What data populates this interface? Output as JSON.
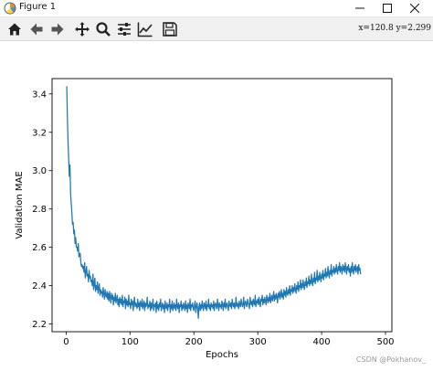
{
  "window": {
    "title": "Figure 1",
    "controls": [
      "minimize",
      "maximize",
      "close"
    ]
  },
  "toolbar": {
    "buttons": [
      "home-icon",
      "back-icon",
      "forward-icon",
      "pan-icon",
      "zoom-icon",
      "configure-subplots-icon",
      "edit-axis-icon",
      "save-icon"
    ],
    "coords": "x=120.8  y=2.299"
  },
  "watermark": "CSDN @Pokhanov_",
  "chart_data": {
    "type": "line",
    "title": "",
    "xlabel": "Epochs",
    "ylabel": "Validation MAE",
    "xlim": [
      -22,
      510
    ],
    "ylim": [
      2.16,
      3.48
    ],
    "xticks": [
      0,
      100,
      200,
      300,
      400,
      500
    ],
    "yticks": [
      2.2,
      2.4,
      2.6,
      2.8,
      3.0,
      3.2,
      3.4
    ],
    "grid": false,
    "line_color": "#1f77b4",
    "series": [
      {
        "name": "",
        "x_start": 1,
        "values": [
          3.44,
          3.28,
          3.15,
          3.06,
          2.97,
          3.03,
          2.88,
          2.83,
          2.78,
          2.72,
          2.73,
          2.67,
          2.69,
          2.62,
          2.65,
          2.6,
          2.6,
          2.58,
          2.62,
          2.55,
          2.56,
          2.57,
          2.52,
          2.5,
          2.51,
          2.49,
          2.5,
          2.47,
          2.52,
          2.44,
          2.47,
          2.5,
          2.45,
          2.46,
          2.42,
          2.48,
          2.44,
          2.45,
          2.42,
          2.43,
          2.4,
          2.46,
          2.38,
          2.41,
          2.44,
          2.37,
          2.4,
          2.38,
          2.42,
          2.36,
          2.39,
          2.41,
          2.35,
          2.38,
          2.36,
          2.37,
          2.34,
          2.39,
          2.36,
          2.33,
          2.38,
          2.35,
          2.34,
          2.37,
          2.33,
          2.36,
          2.32,
          2.37,
          2.34,
          2.31,
          2.36,
          2.33,
          2.35,
          2.3,
          2.34,
          2.32,
          2.36,
          2.31,
          2.33,
          2.35,
          2.3,
          2.33,
          2.29,
          2.34,
          2.31,
          2.33,
          2.3,
          2.35,
          2.29,
          2.32,
          2.31,
          2.34,
          2.28,
          2.33,
          2.3,
          2.32,
          2.29,
          2.35,
          2.3,
          2.31,
          2.28,
          2.33,
          2.3,
          2.32,
          2.27,
          2.31,
          2.34,
          2.29,
          2.31,
          2.3,
          2.28,
          2.33,
          2.29,
          2.31,
          2.27,
          2.32,
          2.3,
          2.29,
          2.33,
          2.28,
          2.3,
          2.32,
          2.27,
          2.31,
          2.29,
          2.3,
          2.34,
          2.28,
          2.3,
          2.29,
          2.32,
          2.27,
          2.31,
          2.28,
          2.3,
          2.33,
          2.27,
          2.3,
          2.29,
          2.31,
          2.26,
          2.32,
          2.28,
          2.3,
          2.27,
          2.31,
          2.29,
          2.33,
          2.27,
          2.29,
          2.31,
          2.28,
          2.3,
          2.26,
          2.32,
          2.29,
          2.28,
          2.31,
          2.27,
          2.3,
          2.29,
          2.33,
          2.26,
          2.3,
          2.28,
          2.32,
          2.27,
          2.29,
          2.31,
          2.28,
          2.3,
          2.27,
          2.33,
          2.29,
          2.28,
          2.31,
          2.26,
          2.3,
          2.29,
          2.32,
          2.27,
          2.3,
          2.28,
          2.31,
          2.29,
          2.27,
          2.32,
          2.28,
          2.3,
          2.26,
          2.31,
          2.29,
          2.28,
          2.33,
          2.27,
          2.3,
          2.29,
          2.31,
          2.28,
          2.27,
          2.3,
          2.32,
          2.26,
          2.29,
          2.31,
          2.28,
          2.23,
          2.29,
          2.31,
          2.27,
          2.3,
          2.28,
          2.32,
          2.29,
          2.27,
          2.31,
          2.3,
          2.28,
          2.32,
          2.27,
          2.3,
          2.29,
          2.33,
          2.28,
          2.3,
          2.27,
          2.31,
          2.29,
          2.3,
          2.28,
          2.32,
          2.27,
          2.3,
          2.31,
          2.29,
          2.28,
          2.33,
          2.3,
          2.27,
          2.31,
          2.29,
          2.3,
          2.28,
          2.32,
          2.3,
          2.27,
          2.31,
          2.29,
          2.33,
          2.28,
          2.3,
          2.31,
          2.29,
          2.27,
          2.32,
          2.3,
          2.29,
          2.31,
          2.28,
          2.33,
          2.3,
          2.29,
          2.31,
          2.28,
          2.3,
          2.34,
          2.29,
          2.31,
          2.3,
          2.28,
          2.32,
          2.3,
          2.29,
          2.33,
          2.31,
          2.29,
          2.3,
          2.34,
          2.28,
          2.31,
          2.32,
          2.3,
          2.29,
          2.33,
          2.31,
          2.3,
          2.28,
          2.34,
          2.31,
          2.3,
          2.32,
          2.29,
          2.33,
          2.31,
          2.3,
          2.35,
          2.29,
          2.32,
          2.31,
          2.33,
          2.3,
          2.34,
          2.31,
          2.29,
          2.33,
          2.32,
          2.35,
          2.3,
          2.33,
          2.31,
          2.34,
          2.32,
          2.3,
          2.35,
          2.33,
          2.31,
          2.34,
          2.32,
          2.36,
          2.31,
          2.33,
          2.35,
          2.32,
          2.34,
          2.37,
          2.32,
          2.35,
          2.33,
          2.36,
          2.34,
          2.31,
          2.36,
          2.34,
          2.37,
          2.33,
          2.35,
          2.38,
          2.34,
          2.36,
          2.33,
          2.38,
          2.35,
          2.37,
          2.34,
          2.39,
          2.36,
          2.35,
          2.38,
          2.36,
          2.4,
          2.35,
          2.38,
          2.37,
          2.4,
          2.36,
          2.39,
          2.37,
          2.41,
          2.38,
          2.36,
          2.4,
          2.38,
          2.42,
          2.37,
          2.4,
          2.39,
          2.43,
          2.38,
          2.41,
          2.39,
          2.43,
          2.4,
          2.38,
          2.42,
          2.4,
          2.44,
          2.39,
          2.42,
          2.41,
          2.45,
          2.4,
          2.43,
          2.41,
          2.46,
          2.42,
          2.4,
          2.44,
          2.42,
          2.47,
          2.41,
          2.44,
          2.43,
          2.48,
          2.42,
          2.45,
          2.43,
          2.47,
          2.44,
          2.42,
          2.46,
          2.44,
          2.48,
          2.43,
          2.46,
          2.45,
          2.49,
          2.44,
          2.47,
          2.45,
          2.5,
          2.46,
          2.44,
          2.48,
          2.46,
          2.51,
          2.45,
          2.48,
          2.47,
          2.5,
          2.46,
          2.49,
          2.47,
          2.51,
          2.48,
          2.46,
          2.5,
          2.48,
          2.52,
          2.47,
          2.5,
          2.49,
          2.46,
          2.51,
          2.48,
          2.5,
          2.47,
          2.52,
          2.49,
          2.46,
          2.5,
          2.48,
          2.51,
          2.47,
          2.49,
          2.45,
          2.5,
          2.47,
          2.52,
          2.48,
          2.46,
          2.5,
          2.48,
          2.51,
          2.47,
          2.49,
          2.5,
          2.46,
          2.51,
          2.48,
          2.49,
          2.46
        ]
      }
    ]
  }
}
